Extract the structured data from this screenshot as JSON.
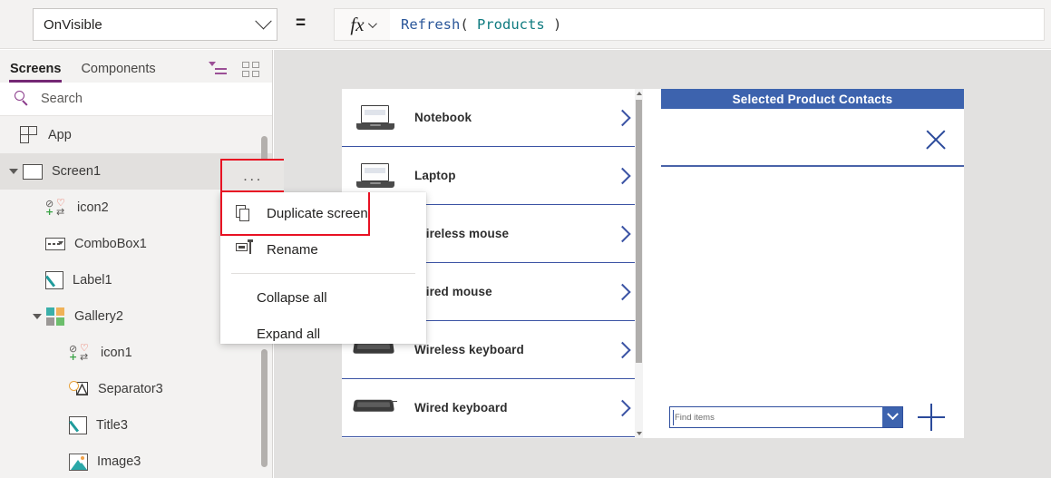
{
  "formula_bar": {
    "property_value": "OnVisible",
    "equals": "=",
    "fx_label": "fx",
    "formula_tokens": [
      {
        "text": "Refresh",
        "kind": "fn"
      },
      {
        "text": "( ",
        "kind": "punc"
      },
      {
        "text": "Products",
        "kind": "tbl"
      },
      {
        "text": " )",
        "kind": "punc"
      }
    ]
  },
  "sidebar": {
    "tabs": [
      {
        "label": "Screens",
        "active": true
      },
      {
        "label": "Components",
        "active": false
      }
    ],
    "view_icons": [
      {
        "name": "tree-view-icon",
        "active": true
      },
      {
        "name": "thumbnail-view-icon",
        "active": false
      }
    ],
    "search": {
      "placeholder": "Search"
    },
    "tree": [
      {
        "label": "App",
        "icon": "app-icon",
        "indent": 0,
        "twisty": "none",
        "selected": false
      },
      {
        "label": "Screen1",
        "icon": "screen-icon",
        "indent": 0,
        "twisty": "expanded",
        "selected": true
      },
      {
        "label": "icon2",
        "icon": "icon-control-icon",
        "indent": 1,
        "twisty": "none",
        "selected": false
      },
      {
        "label": "ComboBox1",
        "icon": "combobox-icon",
        "indent": 1,
        "twisty": "none",
        "selected": false
      },
      {
        "label": "Label1",
        "icon": "label-icon",
        "indent": 1,
        "twisty": "none",
        "selected": false
      },
      {
        "label": "Gallery2",
        "icon": "gallery-icon",
        "indent": 1,
        "twisty": "expanded",
        "selected": false
      },
      {
        "label": "icon1",
        "icon": "icon-control-icon",
        "indent": 2,
        "twisty": "none",
        "selected": false
      },
      {
        "label": "Separator3",
        "icon": "separator-icon",
        "indent": 2,
        "twisty": "none",
        "selected": false
      },
      {
        "label": "Title3",
        "icon": "label-icon",
        "indent": 2,
        "twisty": "none",
        "selected": false
      },
      {
        "label": "Image3",
        "icon": "image-icon",
        "indent": 2,
        "twisty": "none",
        "selected": false
      }
    ]
  },
  "context_menu": {
    "anchor_label": "...",
    "highlight_color": "#e81123",
    "items": [
      {
        "label": "Duplicate screen",
        "icon": "duplicate-icon",
        "highlighted": true
      },
      {
        "label": "Rename",
        "icon": "rename-icon",
        "highlighted": false
      },
      {
        "label": "Collapse all",
        "icon": "",
        "highlighted": false
      },
      {
        "label": "Expand all",
        "icon": "",
        "highlighted": false
      }
    ]
  },
  "canvas": {
    "gallery": {
      "items": [
        {
          "title": "Notebook",
          "thumb": "laptop-thumb"
        },
        {
          "title": "Laptop",
          "thumb": "laptop-thumb"
        },
        {
          "title": "Wireless mouse",
          "thumb": "mouse-thumb"
        },
        {
          "title": "Wired mouse",
          "thumb": "mouse-thumb"
        },
        {
          "title": "Wireless keyboard",
          "thumb": "keyboard-thumb"
        },
        {
          "title": "Wired keyboard",
          "thumb": "keyboard-thumb"
        }
      ],
      "chevron_color": "#3b53a4"
    },
    "right_panel": {
      "title": "Selected Product Contacts",
      "title_bg": "#3d63ae",
      "close_icon": "close-icon",
      "find_placeholder": "Find items",
      "add_icon": "add-icon"
    }
  }
}
